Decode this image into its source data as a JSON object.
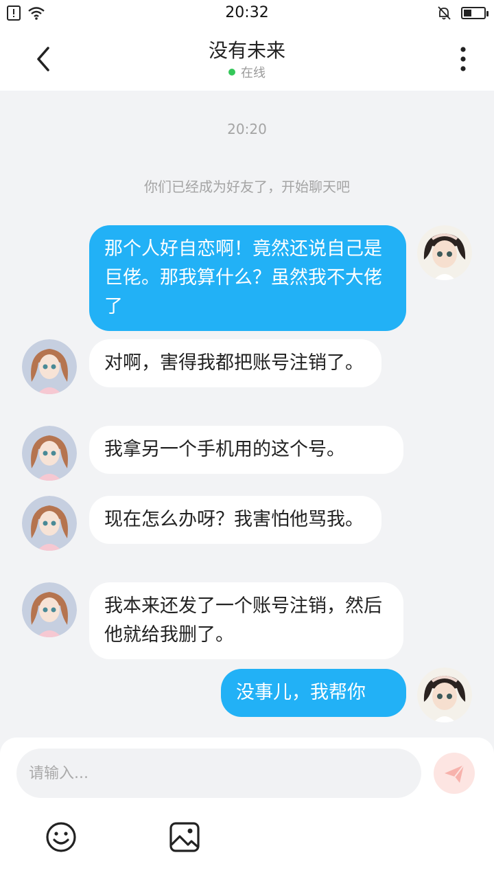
{
  "status_bar": {
    "time": "20:32"
  },
  "header": {
    "title": "没有未来",
    "status": "在线"
  },
  "chat": {
    "time_label": "20:20",
    "system_message": "你们已经成为好友了，开始聊天吧",
    "messages": [
      {
        "from": "me",
        "text": "那个人好自恋啊！竟然还说自己是巨佬。那我算什么？虽然我不大佬了"
      },
      {
        "from": "other",
        "text": "对啊，害得我都把账号注销了。"
      },
      {
        "from": "other",
        "text": "我拿另一个手机用的这个号。"
      },
      {
        "from": "other",
        "text": "现在怎么办呀？我害怕他骂我。"
      },
      {
        "from": "other",
        "text": "我本来还发了一个账号注销，然后他就给我删了。"
      },
      {
        "from": "me",
        "text": "没事儿，我帮你"
      }
    ]
  },
  "input_bar": {
    "placeholder": "请输入..."
  },
  "icons": {
    "back": "chevron-left-icon",
    "more": "more-vertical-icon",
    "send": "send-icon",
    "emoji": "emoji-icon",
    "image": "image-icon"
  },
  "colors": {
    "my_bubble": "#22b1f6",
    "other_bubble": "#ffffff",
    "online": "#34c759",
    "send_button": "#fde5e2"
  }
}
